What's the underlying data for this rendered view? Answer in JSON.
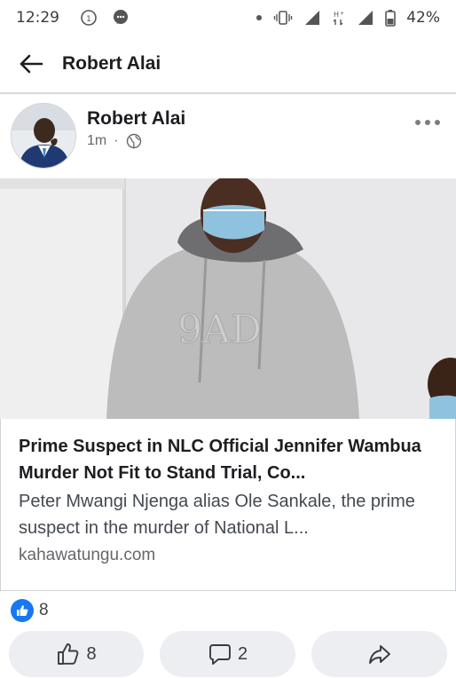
{
  "status_bar": {
    "time": "12:29",
    "battery": "42%"
  },
  "nav": {
    "title": "Robert Alai"
  },
  "post": {
    "author": "Robert Alai",
    "time_ago": "1m",
    "separator": "·",
    "link": {
      "title": "Prime Suspect in NLC Official Jennifer Wambua Murder Not Fit to Stand Trial, Co...",
      "description": "Peter Mwangi Njenga alias Ole Sankale, the prime suspect in the murder of National L...",
      "domain": "kahawatungu.com"
    },
    "reaction_count": "8"
  },
  "actions": {
    "like_count": "8",
    "comment_count": "2"
  },
  "icons": {
    "back": "back-arrow-icon",
    "globe": "globe-icon",
    "more": "more-options-icon",
    "like": "thumbs-up-icon",
    "comment": "comment-icon",
    "share": "share-icon"
  },
  "colors": {
    "accent": "#1877f2",
    "button_bg": "#eceef1",
    "secondary_text": "#65676b"
  }
}
